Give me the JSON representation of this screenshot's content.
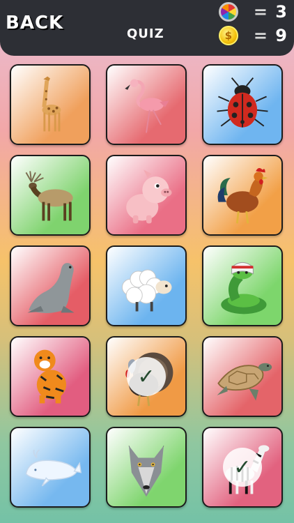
{
  "header": {
    "back_label": "BACK",
    "title": "QUIZ",
    "stats": [
      {
        "icon": "color-wheel-icon",
        "eq": "=",
        "value": "3"
      },
      {
        "icon": "gold-coin-icon",
        "coin_symbol": "$",
        "eq": "=",
        "value": "9"
      }
    ]
  },
  "cards": [
    {
      "animal": "giraffe",
      "bg": "#f0a05c",
      "checked": false
    },
    {
      "animal": "flamingo",
      "bg": "#e66a70",
      "checked": false
    },
    {
      "animal": "ladybug",
      "bg": "#6fb5f0",
      "checked": false
    },
    {
      "animal": "elk",
      "bg": "#7fd36e",
      "checked": false
    },
    {
      "animal": "pig",
      "bg": "#ea6f86",
      "checked": false
    },
    {
      "animal": "rooster",
      "bg": "#f2a047",
      "checked": false
    },
    {
      "animal": "seal",
      "bg": "#e55d66",
      "checked": false
    },
    {
      "animal": "sheep",
      "bg": "#6cb4ef",
      "checked": false
    },
    {
      "animal": "snake",
      "bg": "#7dd66c",
      "checked": false
    },
    {
      "animal": "tiger",
      "bg": "#e25d80",
      "checked": false
    },
    {
      "animal": "turkey",
      "bg": "#f09a45",
      "checked": true
    },
    {
      "animal": "turtle",
      "bg": "#e46469",
      "checked": false
    },
    {
      "animal": "whale",
      "bg": "#76b8ef",
      "checked": false
    },
    {
      "animal": "wolf",
      "bg": "#7fd56e",
      "checked": false
    },
    {
      "animal": "zebra",
      "bg": "#e2627f",
      "checked": true
    }
  ],
  "check_symbol": "✓"
}
